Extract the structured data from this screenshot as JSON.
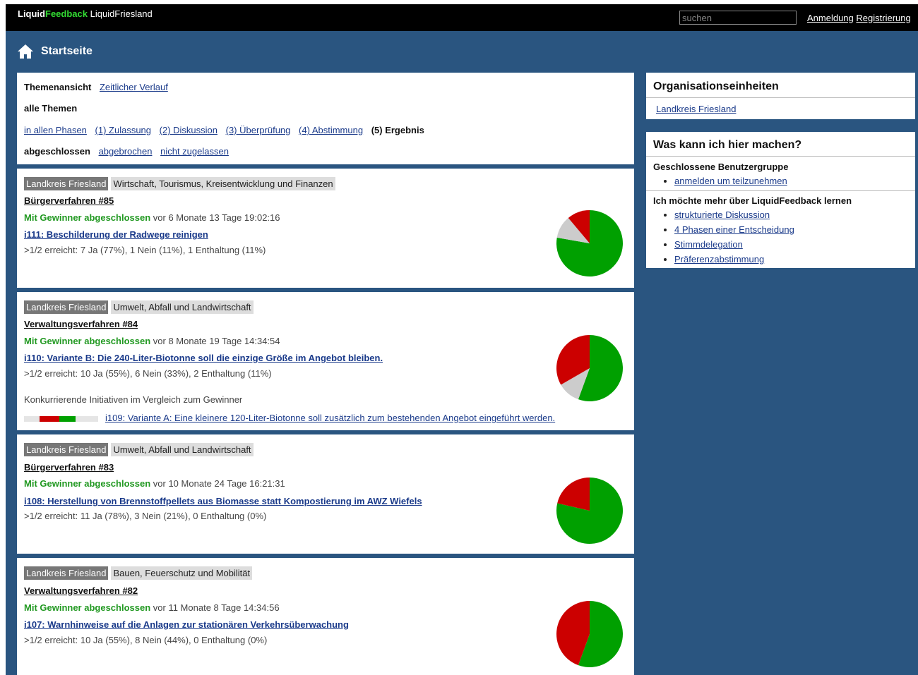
{
  "brand": {
    "part1": "Liquid",
    "part2": "Feedback",
    "instance": "LiquidFriesland"
  },
  "header": {
    "search_placeholder": "suchen",
    "login": "Anmeldung",
    "register": "Registrierung"
  },
  "breadcrumb": {
    "title": "Startseite",
    "icon": "home-icon"
  },
  "filters": {
    "view_label": "Themenansicht",
    "view_alt": "Zeitlicher Verlauf",
    "scope_label": "alle Themen",
    "phases": [
      "in allen Phasen",
      "(1) Zulassung",
      "(2) Diskussion",
      "(3) Überprüfung",
      "(4) Abstimmung"
    ],
    "phase_selected": "(5) Ergebnis",
    "closed_selected": "abgeschlossen",
    "closed_options": [
      "abgebrochen",
      "nicht zugelassen"
    ]
  },
  "colors": {
    "yes": "#00a000",
    "no": "#cc0000",
    "abstain": "#cccccc",
    "frame": "#2a5580",
    "brand_green": "#33dd33"
  },
  "issues": [
    {
      "unit": "Landkreis Friesland",
      "area": "Wirtschaft, Tourismus, Kreisentwicklung und Finanzen",
      "title": "Bürgerverfahren #85",
      "status": "Mit Gewinner abgeschlossen",
      "time": "vor 6 Monate 13 Tage 19:02:16",
      "initiative": "i111: Beschilderung der Radwege reinigen",
      "result": ">1/2 erreicht: 7 Ja (77%), 1 Nein (11%), 1 Enthaltung (11%)",
      "votes": {
        "yes": 7,
        "no": 1,
        "abstain": 1
      }
    },
    {
      "unit": "Landkreis Friesland",
      "area": "Umwelt, Abfall und Landwirtschaft",
      "title": "Verwaltungsverfahren #84",
      "status": "Mit Gewinner abgeschlossen",
      "time": "vor 8 Monate 19 Tage 14:34:54",
      "initiative": "i110: Variante B: Die 240-Liter-Biotonne soll die einzige Größe im Angebot bleiben.",
      "result": ">1/2 erreicht: 10 Ja (55%), 6 Nein (33%), 2 Enthaltung (11%)",
      "votes": {
        "yes": 10,
        "no": 6,
        "abstain": 2
      },
      "competing_label": "Konkurrierende Initiativen im Vergleich zum Gewinner",
      "competing": {
        "text": "i109: Variante A: Eine kleinere 120-Liter-Biotonne soll zusätzlich zum bestehenden Angebot eingeführt werden.",
        "bar": {
          "abstain_left": 0.21,
          "no": 0.26,
          "yes": 0.22,
          "rest": 0.31
        }
      }
    },
    {
      "unit": "Landkreis Friesland",
      "area": "Umwelt, Abfall und Landwirtschaft",
      "title": "Bürgerverfahren #83",
      "status": "Mit Gewinner abgeschlossen",
      "time": "vor 10 Monate 24 Tage 16:21:31",
      "initiative": "i108: Herstellung von Brennstoffpellets aus Biomasse statt Kompostierung im AWZ Wiefels",
      "result": ">1/2 erreicht: 11 Ja (78%), 3 Nein (21%), 0 Enthaltung (0%)",
      "votes": {
        "yes": 11,
        "no": 3,
        "abstain": 0
      }
    },
    {
      "unit": "Landkreis Friesland",
      "area": "Bauen, Feuerschutz und Mobilität",
      "title": "Verwaltungsverfahren #82",
      "status": "Mit Gewinner abgeschlossen",
      "time": "vor 11 Monate 8 Tage 14:34:56",
      "initiative": "i107: Warnhinweise auf die Anlagen zur stationären Verkehrsüberwachung",
      "result": ">1/2 erreicht: 10 Ja (55%), 8 Nein (44%), 0 Enthaltung (0%)",
      "votes": {
        "yes": 10,
        "no": 8,
        "abstain": 0
      }
    }
  ],
  "sidebar": {
    "units_title": "Organisationseinheiten",
    "units": [
      "Landkreis Friesland"
    ],
    "help_title": "Was kann ich hier machen?",
    "closed_group": "Geschlossene Benutzergruppe",
    "closed_links": [
      "anmelden um teilzunehmen"
    ],
    "learn_title": "Ich möchte mehr über LiquidFeedback lernen",
    "learn_links": [
      "strukturierte Diskussion",
      "4 Phasen einer Entscheidung",
      "Stimmdelegation",
      "Präferenzabstimmung"
    ]
  }
}
